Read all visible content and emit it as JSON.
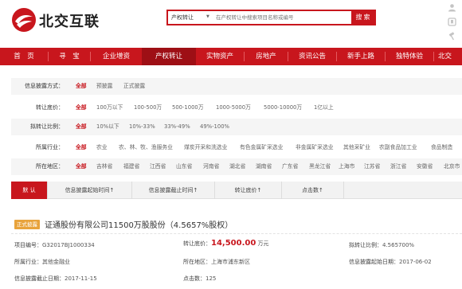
{
  "header": {
    "logo_text": "北交互联",
    "search": {
      "category": "产权转让",
      "placeholder": "在产权转让中搜索项目名称或编号",
      "button": "搜索"
    }
  },
  "nav": {
    "items": [
      {
        "label": "首　页",
        "active": false
      },
      {
        "label": "寻　宝",
        "active": false
      },
      {
        "label": "企业增资",
        "active": false
      },
      {
        "label": "产权转让",
        "active": true
      },
      {
        "label": "实物资产",
        "active": false
      },
      {
        "label": "房地产",
        "active": false
      },
      {
        "label": "资讯公告",
        "active": false
      },
      {
        "label": "新手上路",
        "active": false
      },
      {
        "label": "独特体验",
        "active": false
      },
      {
        "label": "北交",
        "active": false
      }
    ]
  },
  "filters": [
    {
      "label": "信息披露方式：",
      "options": [
        "全部",
        "预披露",
        "正式披露"
      ]
    },
    {
      "label": "转让底价：",
      "options": [
        "全部",
        "100万以下",
        "100-500万",
        "500-1000万",
        "1000-5000万",
        "5000-10000万",
        "1亿以上"
      ]
    },
    {
      "label": "拟转让比例：",
      "options": [
        "全部",
        "10%以下",
        "10%-33%",
        "33%-49%",
        "49%-100%"
      ]
    },
    {
      "label": "所属行业：",
      "options": [
        "全部",
        "农业",
        "农、林、牧、渔服务业",
        "煤炭开采和洗选业",
        "有色金属矿采选业",
        "非金属矿采选业",
        "其他采矿业",
        "农副食品加工业",
        "食品制造"
      ]
    },
    {
      "label": "所在地区：",
      "options": [
        "全部",
        "吉林省",
        "福建省",
        "江西省",
        "山东省",
        "河南省",
        "湖北省",
        "湖南省",
        "广东省",
        "黑龙江省",
        "上海市",
        "江苏省",
        "浙江省",
        "安徽省",
        "北京市"
      ]
    }
  ],
  "sortbar": {
    "items": [
      "默  认",
      "信息披露起始时间↑",
      "信息披露截止时间↑",
      "转让底价↑",
      "点击数↑"
    ]
  },
  "listing": {
    "badge": "正式披露",
    "title": "证通股份有限公司11500万股股份（4.5657%股权）",
    "fields": [
      {
        "key": "项目编号：",
        "value": "G32017BJ1000334"
      },
      {
        "key": "转让底价：",
        "value": "14,500.00",
        "unit": "万元"
      },
      {
        "key": "拟转让比例：",
        "value": "4.565700%"
      },
      {
        "key": "所属行业：",
        "value": "其他金融业"
      },
      {
        "key": "所在地区：",
        "value": "上海市浦东新区"
      },
      {
        "key": "信息披露起始日期：",
        "value": "2017-06-02"
      },
      {
        "key": "信息披露截止日期：",
        "value": "2017-11-15"
      },
      {
        "key": "点击数：",
        "value": "125"
      }
    ]
  },
  "colors": {
    "brand": "#c8161d",
    "badge": "#e8a33c"
  },
  "icons": [
    "logo-icon",
    "user-icon",
    "bookmark-icon",
    "hammer-icon",
    "chevron-down-icon"
  ]
}
